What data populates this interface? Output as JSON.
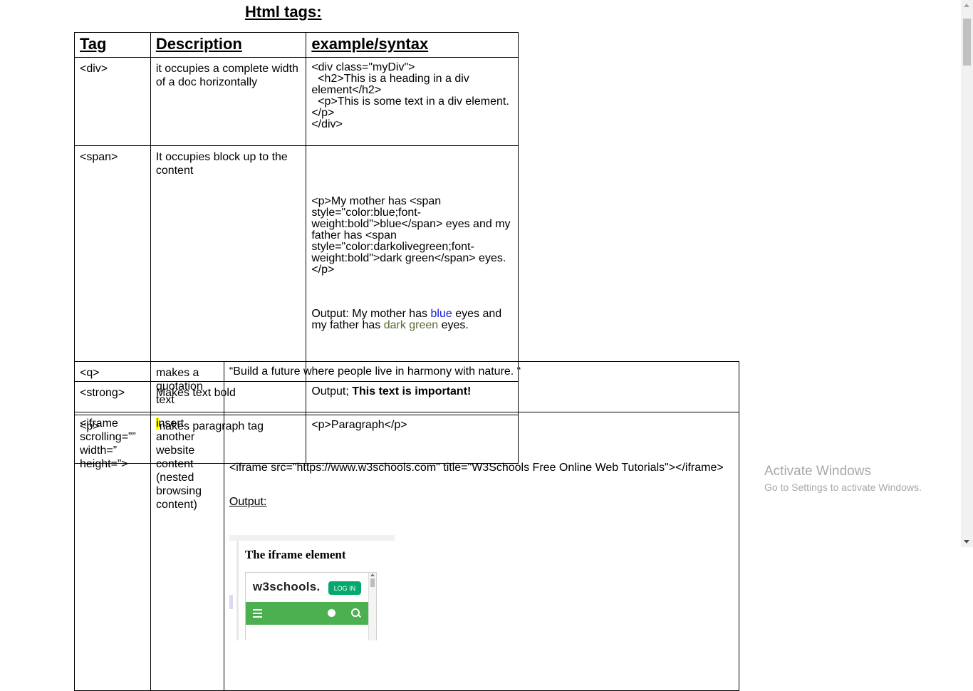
{
  "title": "Html tags:",
  "table1": {
    "headers": [
      "Tag",
      "Description",
      "example/syntax"
    ],
    "rows": [
      {
        "tag": "<div>",
        "description": "it occupies a complete width of a doc horizontally",
        "example": "<div class=\"myDiv\">\n  <h2>This is a heading in a div element</h2>\n  <p>This is some text in a div element.</p>\n</div>"
      },
      {
        "tag": "<span>",
        "description": "It occupies block up to the content",
        "example": "<p>My mother has <span style=\"color:blue;font-weight:bold\">blue</span> eyes and my father has <span style=\"color:darkolivegreen;font-weight:bold\">dark green</span> eyes.</p>",
        "output_prefix": "Output: My mother has ",
        "output_blue": "blue",
        "output_middle": " eyes and my father has ",
        "output_green": "dark green",
        "output_suffix": " eyes."
      },
      {
        "tag": "<strong>",
        "description": "Makes text bold",
        "output_prefix": "Output; ",
        "output_bold": "This text is important!"
      },
      {
        "tag": "<p>",
        "description": "makes paragraph tag",
        "example": "<p>Paragraph</p>"
      }
    ]
  },
  "table2": {
    "rows": [
      {
        "tag": "<q>",
        "description": "makes a quotation text",
        "example": "“Build a future where people live in harmony with nature. “"
      },
      {
        "tag": "<iframe scrolling=”” width=” height=”>",
        "description_first": "i",
        "description_rest": "nsert another website content (nested browsing content)",
        "example": "<iframe src=\"https://www.w3schools.com\" title=\"W3Schools Free Online Web Tutorials\"></iframe>",
        "output_label": "Output:",
        "preview": {
          "heading": "The iframe element",
          "logo": "w3schools.",
          "login": "LOG IN"
        }
      }
    ]
  },
  "watermark": {
    "title": "Activate Windows",
    "subtitle": "Go to Settings to activate Windows."
  }
}
